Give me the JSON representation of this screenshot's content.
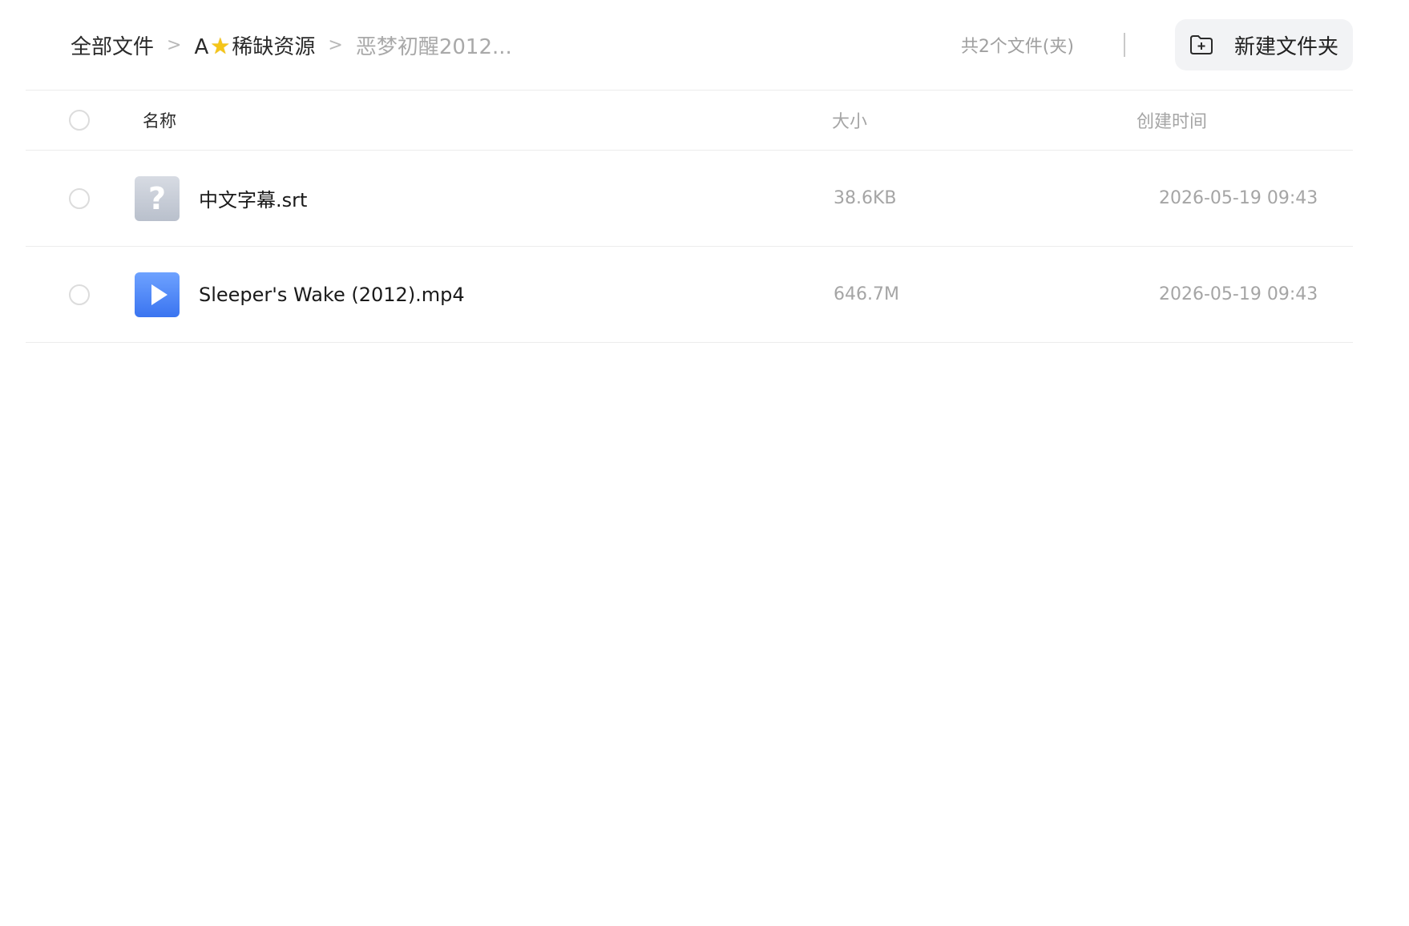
{
  "breadcrumb": {
    "root": "全部文件",
    "level1_prefix": "A",
    "level1_icon": "star-icon",
    "level1_suffix": "稀缺资源",
    "current": "恶梦初醒2012...",
    "separator": ">"
  },
  "header": {
    "file_count": "共2个文件(夹)",
    "new_folder_label": "新建文件夹",
    "new_folder_icon": "folder-plus-icon"
  },
  "table": {
    "columns": {
      "name": "名称",
      "size": "大小",
      "time": "创建时间"
    },
    "rows": [
      {
        "icon": "unknown-file-icon",
        "icon_glyph": "?",
        "name": "中文字幕.srt",
        "size": "38.6KB",
        "time": "2026-05-19 09:43"
      },
      {
        "icon": "video-file-icon",
        "name": "Sleeper's Wake (2012).mp4",
        "size": "646.7M",
        "time": "2026-05-19 09:43"
      }
    ]
  },
  "colors": {
    "accent_video": "#3a74f0",
    "muted_text": "#a5a5a5",
    "button_bg": "#f2f3f5"
  }
}
